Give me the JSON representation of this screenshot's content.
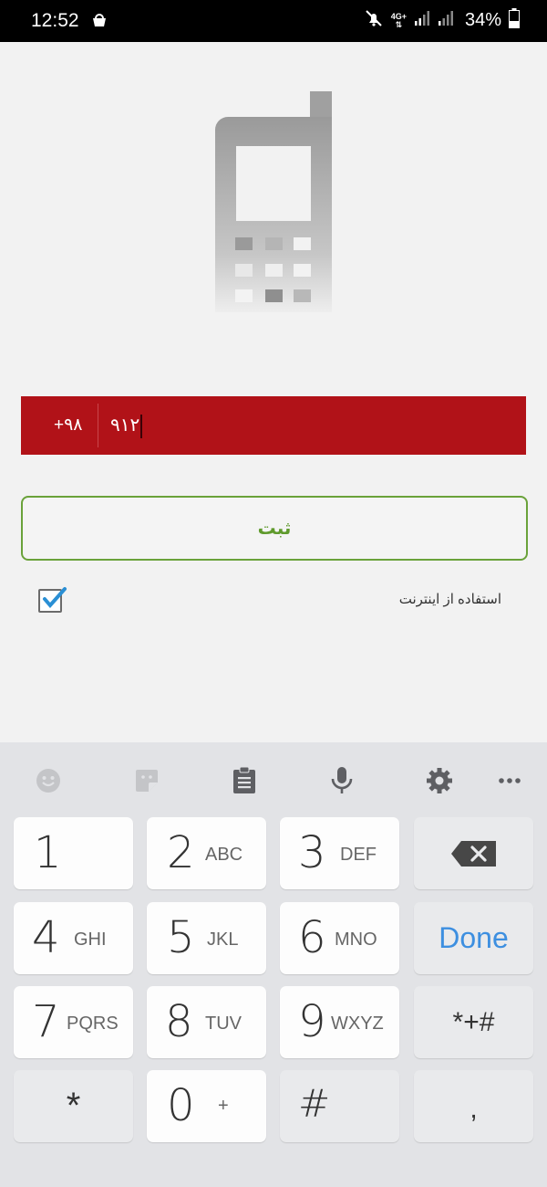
{
  "status_bar": {
    "time": "12:52",
    "network_top": "4G+",
    "battery": "34%",
    "icons": [
      "shopping-bag-icon",
      "mute-icon",
      "data-arrows-icon",
      "signal-icon",
      "signal-icon-2",
      "battery-icon"
    ]
  },
  "form": {
    "country_code": "+۹۸",
    "phone_value": "۹۱۲",
    "submit_label": "ثبت",
    "use_internet_label": "استفاده از اینترنت",
    "use_internet_checked": true
  },
  "colors": {
    "accent_red": "#b11218",
    "submit_green": "#5f9a2c",
    "done_blue": "#3d8fe0"
  },
  "keyboard": {
    "toolbar": [
      "emoji-icon",
      "sticker-icon",
      "clipboard-icon",
      "microphone-icon",
      "gear-icon",
      "more-icon"
    ],
    "keys": [
      {
        "digit": "1",
        "letters": ""
      },
      {
        "digit": "2",
        "letters": "ABC"
      },
      {
        "digit": "3",
        "letters": "DEF"
      },
      {
        "digit": "4",
        "letters": "GHI"
      },
      {
        "digit": "5",
        "letters": "JKL"
      },
      {
        "digit": "6",
        "letters": "MNO"
      },
      {
        "digit": "7",
        "letters": "PQRS"
      },
      {
        "digit": "8",
        "letters": "TUV"
      },
      {
        "digit": "9",
        "letters": "WXYZ"
      },
      {
        "digit": "*",
        "letters": ""
      },
      {
        "digit": "0",
        "letters": "+"
      },
      {
        "digit": "#",
        "letters": ""
      }
    ],
    "done_label": "Done",
    "symbols_label": "*+#",
    "comma_label": ","
  }
}
